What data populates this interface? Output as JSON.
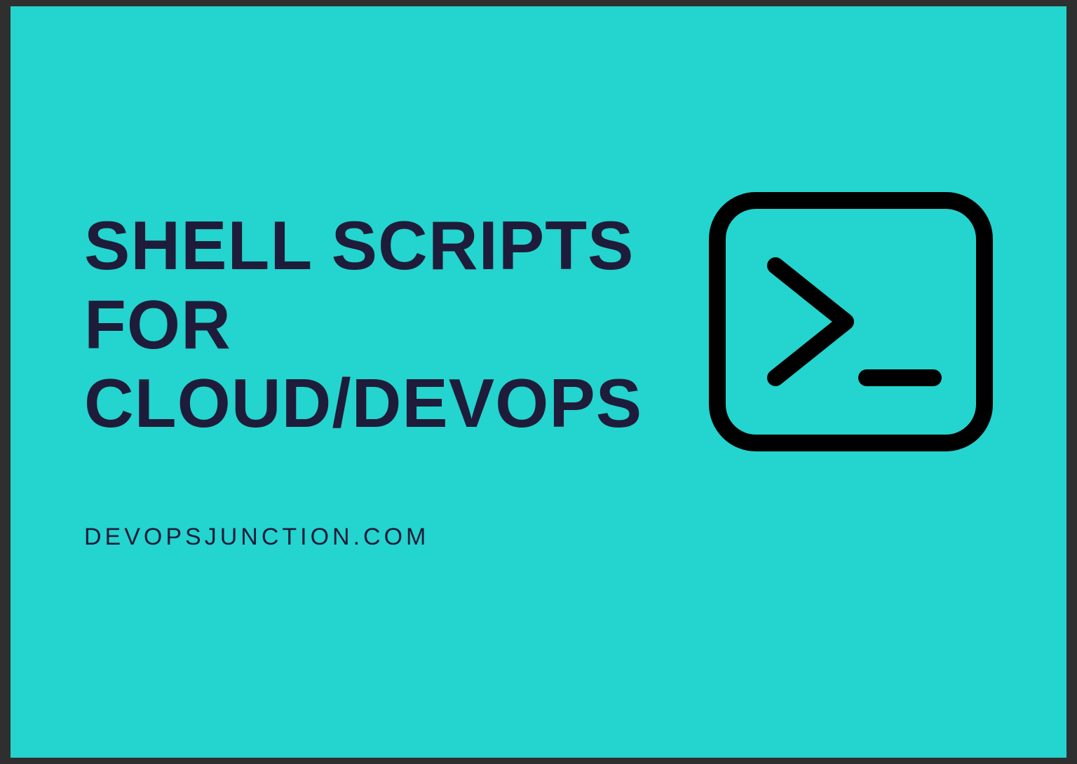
{
  "banner": {
    "headline_line1": "SHELL SCRIPTS",
    "headline_line2": "FOR",
    "headline_line3": "CLOUD/DEVOPS",
    "subtitle": "DEVOPSJUNCTION.COM",
    "icon_name": "terminal-icon",
    "bg_color": "#24d4ce",
    "text_color": "#1e1c3a"
  }
}
